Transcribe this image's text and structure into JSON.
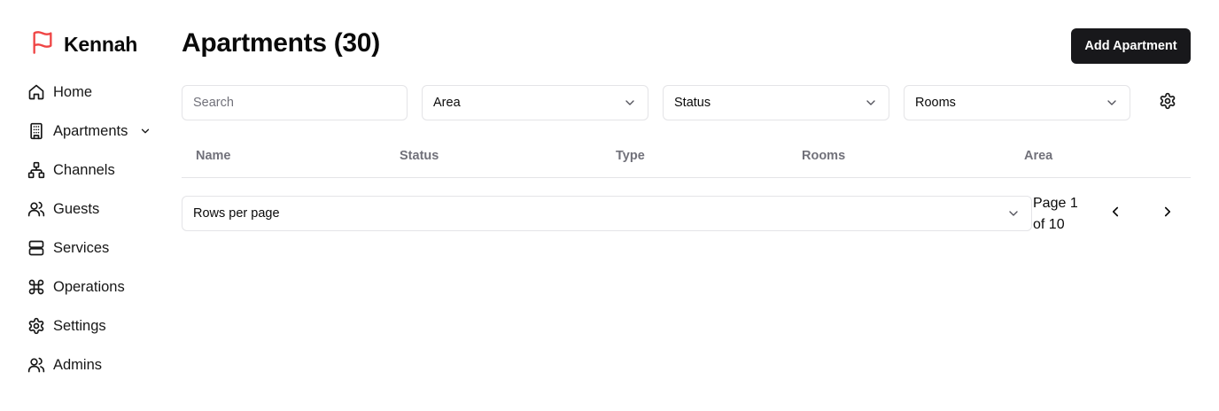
{
  "brand": {
    "name": "Kennah",
    "logo_icon": "flag-icon",
    "logo_color": "#ef4444"
  },
  "sidebar": {
    "items": [
      {
        "label": "Home",
        "icon": "home-icon"
      },
      {
        "label": "Apartments",
        "icon": "building-icon",
        "expandable": true
      },
      {
        "label": "Channels",
        "icon": "network-icon"
      },
      {
        "label": "Guests",
        "icon": "users-icon"
      },
      {
        "label": "Services",
        "icon": "server-icon"
      },
      {
        "label": "Operations",
        "icon": "command-icon"
      },
      {
        "label": "Settings",
        "icon": "gear-icon"
      },
      {
        "label": "Admins",
        "icon": "users-icon"
      }
    ]
  },
  "header": {
    "title": "Apartments (30)",
    "add_button": "Add Apartment"
  },
  "filters": {
    "search_placeholder": "Search",
    "area": "Area",
    "status": "Status",
    "rooms": "Rooms"
  },
  "table": {
    "columns": [
      "Name",
      "Status",
      "Type",
      "Rooms",
      "Area"
    ],
    "rows": []
  },
  "pagination": {
    "rows_per_page_label": "Rows per page",
    "page_line1": "Page 1",
    "page_line2": "of 10"
  },
  "colors": {
    "primary_button": "#18181b",
    "border": "#e4e4e7",
    "muted_text": "#71717a"
  }
}
